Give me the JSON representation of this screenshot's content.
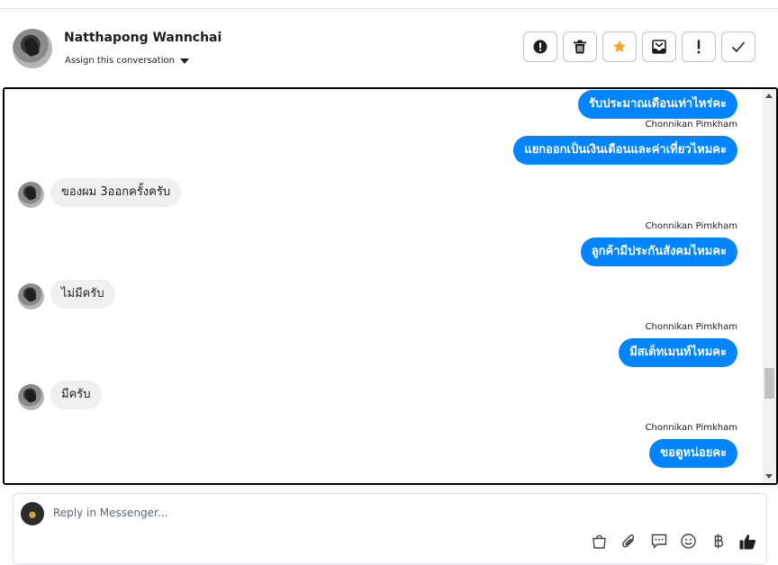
{
  "header": {
    "contact_name": "Natthapong Wannchai",
    "assign_label": "Assign this conversation",
    "actions": [
      {
        "name": "report-spam-button",
        "icon": "exclamation-circle-icon"
      },
      {
        "name": "delete-button",
        "icon": "trash-icon"
      },
      {
        "name": "star-button",
        "icon": "star-icon",
        "color": "#f5a623"
      },
      {
        "name": "archive-button",
        "icon": "inbox-archive-icon"
      },
      {
        "name": "follow-up-button",
        "icon": "exclamation-icon"
      },
      {
        "name": "mark-done-button",
        "icon": "checkmark-icon"
      }
    ]
  },
  "messages": [
    {
      "direction": "out",
      "sender": "",
      "text": "รับประมาณเดือนเท่าไหร่คะ"
    },
    {
      "direction": "out",
      "sender": "Chonnikan Pimkham",
      "text": "แยกออกเป็นเงินเดือนและค่าเที่ยวไหมคะ"
    },
    {
      "direction": "in",
      "text": "ของผม 3ออกครั้งครับ"
    },
    {
      "direction": "out",
      "sender": "Chonnikan Pimkham",
      "text": "ลูกค้ามีประกันสังคมไหมคะ"
    },
    {
      "direction": "in",
      "text": "ไม่มีครับ"
    },
    {
      "direction": "out",
      "sender": "Chonnikan Pimkham",
      "text": "มีสเต็ทเมนท์ไหมคะ"
    },
    {
      "direction": "in",
      "text": "มีครับ"
    },
    {
      "direction": "out",
      "sender": "Chonnikan Pimkham",
      "text": "ขอดูหน่อยคะ"
    }
  ],
  "composer": {
    "placeholder": "Reply in Messenger...",
    "icons": [
      "shopping-bag-icon",
      "paperclip-icon",
      "saved-reply-icon",
      "emoji-icon",
      "baht-icon",
      "thumbs-up-icon"
    ]
  },
  "colors": {
    "outgoing_bubble": "#0084ff",
    "incoming_bubble": "#f0f0f0",
    "star": "#f5a623"
  }
}
